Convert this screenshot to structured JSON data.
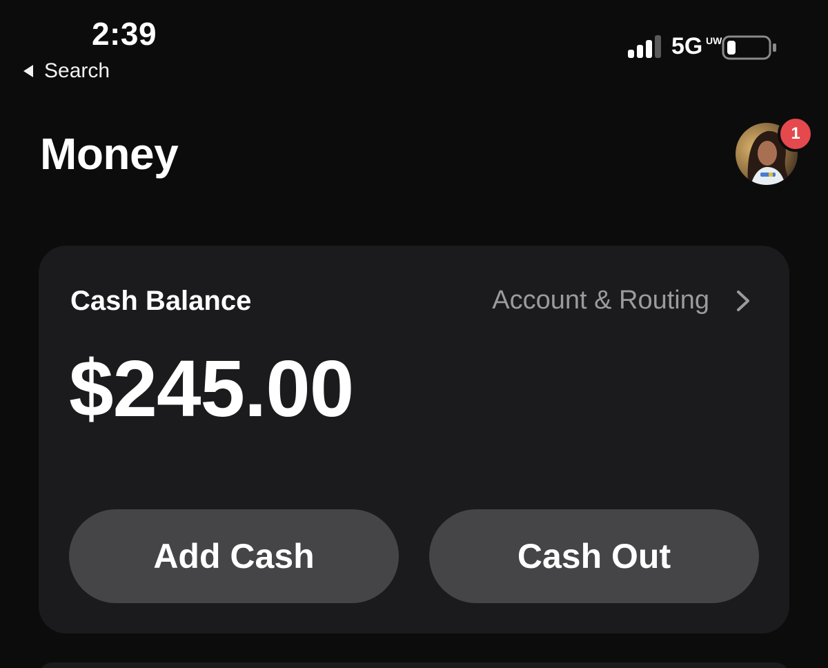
{
  "status_bar": {
    "time": "2:39",
    "back_label": "Search",
    "network": "5G",
    "network_sub": "UW",
    "signal_icon": "signal-bars-icon",
    "battery_icon": "battery-icon"
  },
  "header": {
    "title": "Money",
    "avatar_icon": "profile-avatar",
    "notification_count": "1"
  },
  "balance_card": {
    "label": "Cash Balance",
    "routing_label": "Account & Routing",
    "routing_icon": "chevron-right-icon",
    "amount": "$245.00",
    "add_cash_label": "Add Cash",
    "cash_out_label": "Cash Out"
  },
  "colors": {
    "background": "#0c0c0c",
    "card": "#1b1b1d",
    "button": "#454547",
    "muted_text": "#9b9b9e",
    "badge": "#e5484d"
  }
}
